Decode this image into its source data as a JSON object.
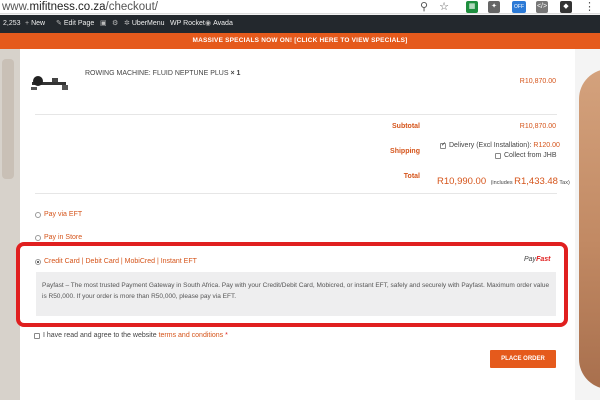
{
  "browser": {
    "url_prefix": "www.",
    "url_host": "mifitness.co.za",
    "url_path": "/checkout/",
    "badge_off": "OFF"
  },
  "adminbar": {
    "count": "2,253",
    "new_label": "New",
    "edit_page_label": "Edit Page",
    "ubermenu_label": "UberMenu",
    "wprocket_label": "WP Rocket",
    "avada_label": "Avada"
  },
  "promo": {
    "text": "MASSIVE SPECIALS NOW ON! [CLICK HERE TO VIEW SPECIALS]"
  },
  "order": {
    "product_name": "ROWING MACHINE: FLUID NEPTUNE PLUS",
    "product_qty": "× 1",
    "product_price": "R10,870.00",
    "subtotal_label": "Subtotal",
    "subtotal_value": "R10,870.00",
    "shipping_label": "Shipping",
    "shipping_option1_text": "Delivery (Excl Installation): ",
    "shipping_option1_price": "R120.00",
    "shipping_option2_text": "Collect from JHB",
    "total_label": "Total",
    "total_value": "R10,990.00",
    "total_includes": "(includes ",
    "total_tax_value": "R1,433.48",
    "total_tax_suffix": " Tax)"
  },
  "payment": {
    "option_eft": "Pay via EFT",
    "option_store": "Pay in Store",
    "option_card": "Credit Card | Debit Card | MobiCred | Instant EFT",
    "payfast_logo_a": "Pay",
    "payfast_logo_b": "Fast",
    "description": "Payfast – The most trusted Payment Gateway in South Africa. Pay with your Credit/Debit Card, Mobicred, or instant EFT, safely and securely with Payfast. Maximum order value is R50,000. If your order is more than R50,000, please pay via EFT."
  },
  "terms": {
    "prefix": "I have read and agree to the website ",
    "link": "terms and conditions",
    "star": " *"
  },
  "buttons": {
    "place_order": "PLACE ORDER"
  },
  "colors": {
    "accent": "#e55a1c",
    "highlight": "#e01f1f",
    "adminbar": "#23282d"
  }
}
